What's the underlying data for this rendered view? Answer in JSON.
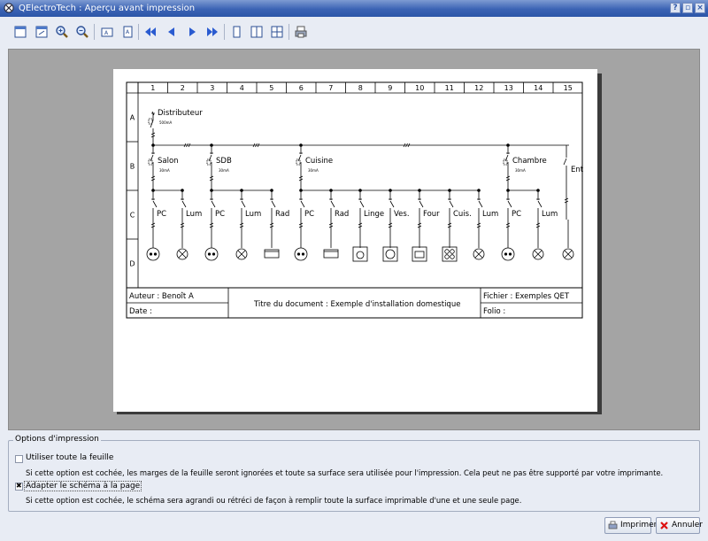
{
  "window": {
    "title": "QElectroTech : Aperçu avant impression"
  },
  "toolbar": {
    "buttons": [
      "page-setup",
      "fit-page",
      "zoom-in",
      "zoom-out",
      "landscape",
      "portrait",
      "first-page",
      "previous-page",
      "next-page",
      "last-page",
      "single-page",
      "facing-pages",
      "all-pages",
      "print-setup"
    ]
  },
  "diagram": {
    "columns": [
      "1",
      "2",
      "3",
      "4",
      "5",
      "6",
      "7",
      "8",
      "9",
      "10",
      "11",
      "12",
      "13",
      "14",
      "15"
    ],
    "rows": [
      "A",
      "B",
      "C",
      "D"
    ],
    "labels": {
      "distributeur": "Distributeur",
      "distributeur_rating": "500mA",
      "salon": "Salon",
      "sdb": "SDB",
      "cuisine": "Cuisine",
      "chambre": "Chambre",
      "ent": "Ent",
      "rating_30": "30mA",
      "pc": "PC",
      "lum": "Lum",
      "rad": "Rad",
      "linge": "Linge",
      "ves": "Ves.",
      "four": "Four",
      "cuis": "Cuis."
    },
    "titleblock": {
      "author": "Auteur : Benoît A",
      "date": "Date :",
      "doc_title": "Titre du document : Exemple d'installation domestique",
      "file": "Fichier : Exemples QET",
      "folio": "Folio :"
    }
  },
  "options": {
    "group_title": "Options d'impression",
    "use_full_sheet": {
      "label": "Utiliser toute la feuille",
      "checked": false,
      "description": "Si cette option est cochée, les marges de la feuille seront ignorées et toute sa surface sera utilisée pour l'impression. Cela peut ne pas être supporté par votre imprimante."
    },
    "fit_schema": {
      "label": "Adapter le schéma à la page",
      "checked": true,
      "description": "Si cette option est cochée, le schéma sera agrandi ou rétréci de façon à remplir toute la surface imprimable d'une et une seule page."
    }
  },
  "buttons": {
    "print": "Imprimer",
    "cancel": "Annuler"
  }
}
